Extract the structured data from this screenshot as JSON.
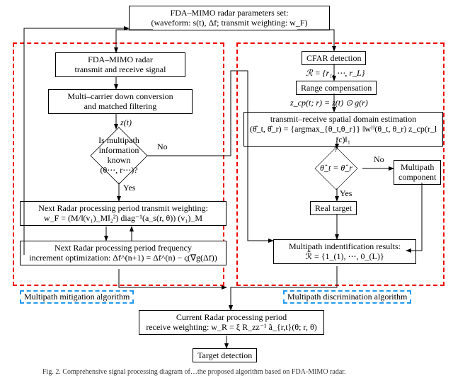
{
  "top": {
    "params": "FDA–MIMO radar parameters set:\n(waveform: s(t), Δf; transmit weighting: w_F)"
  },
  "left": {
    "panel_label": "Multipath mitigation algorithm",
    "n1": "FDA–MIMO radar\ntransmit and receive signal",
    "n2": "Multi–carrier down conversion\nand matched filtering",
    "z": "z(t)",
    "q": "Is multipath\ninformation known\n(θ⋯, r⋯)?",
    "yes": "Yes",
    "no": "No",
    "n3": "Next Radar processing period transmit weighting:\nw_F = (M/‖(v₁)_M‖₂²) diag⁻¹(a_s(r, θ)) (v₁)_M",
    "n4": "Next Radar processing period frequency\nincrement optimization: Δf^(n+1) = Δf^(n) − ς(∇g(Δf))"
  },
  "right": {
    "panel_label": "Multipath discrimination algorithm",
    "r1": "CFAR detection",
    "rset": "ℛ = {r₁, ⋯, r_L}",
    "r2": "Range compensation",
    "zcp": "z_cp(t; r) = z(t) ⊙ g(r)",
    "r3": "transmit–receive spatial domain estimation\n(θ̂_t, θ̂_r) = {argmax_{θ_t,θ_r}} ‖wᴴ(θ_t, θ_r) z_cp(r_l /c)‖₁",
    "q2": "θ̂_t = θ̂_r",
    "qmark": "?",
    "yes": "Yes",
    "no": "No",
    "mp": "Multipath\ncomponent",
    "rt": "Real target",
    "r4": "Multipath indentification results:\nℛ̃ = {1_(1), ⋯, 0_(L)}"
  },
  "bottom": {
    "b1": "Current Radar processing period\nreceive weighting: w_R = ξ R_zz⁻¹ ã_{r,t}(θ; r, θ)",
    "b2": "Target detection"
  },
  "caption": "Fig. 2.   Comprehensive signal processing diagram of…the proposed algorithm based on FDA-MIMO radar."
}
